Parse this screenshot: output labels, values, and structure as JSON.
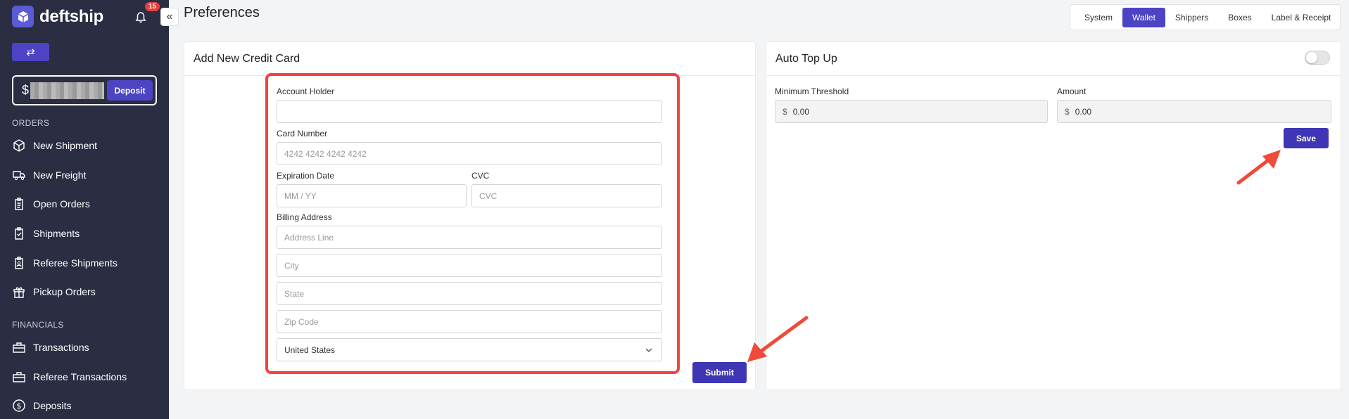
{
  "sidebar": {
    "brand": "deftship",
    "notification_count": "15",
    "balance_symbol": "$",
    "deposit_label": "Deposit",
    "orders_label": "ORDERS",
    "orders_items": [
      "New Shipment",
      "New Freight",
      "Open Orders",
      "Shipments",
      "Referee Shipments",
      "Pickup Orders"
    ],
    "financials_label": "FINANCIALS",
    "financials_items": [
      "Transactions",
      "Referee Transactions",
      "Deposits"
    ]
  },
  "header": {
    "title": "Preferences",
    "tabs": [
      {
        "label": "System"
      },
      {
        "label": "Wallet",
        "active": true
      },
      {
        "label": "Shippers"
      },
      {
        "label": "Boxes"
      },
      {
        "label": "Label & Receipt"
      }
    ]
  },
  "credit_card": {
    "title": "Add New Credit Card",
    "account_holder_label": "Account Holder",
    "account_holder_value": "",
    "card_number_label": "Card Number",
    "card_number_placeholder": "4242 4242 4242 4242",
    "expiration_label": "Expiration Date",
    "expiration_placeholder": "MM / YY",
    "cvc_label": "CVC",
    "cvc_placeholder": "CVC",
    "billing_label": "Billing Address",
    "address_placeholder": "Address Line",
    "city_placeholder": "City",
    "state_placeholder": "State",
    "zip_placeholder": "Zip Code",
    "country_value": "United States",
    "submit_label": "Submit"
  },
  "auto_top_up": {
    "title": "Auto Top Up",
    "enabled": false,
    "threshold_label": "Minimum Threshold",
    "amount_label": "Amount",
    "currency": "$",
    "threshold_value": "0.00",
    "amount_value": "0.00",
    "save_label": "Save"
  },
  "colors": {
    "sidebar_bg": "#2b2d42",
    "primary": "#3f36b5",
    "highlight": "#ef4444"
  }
}
